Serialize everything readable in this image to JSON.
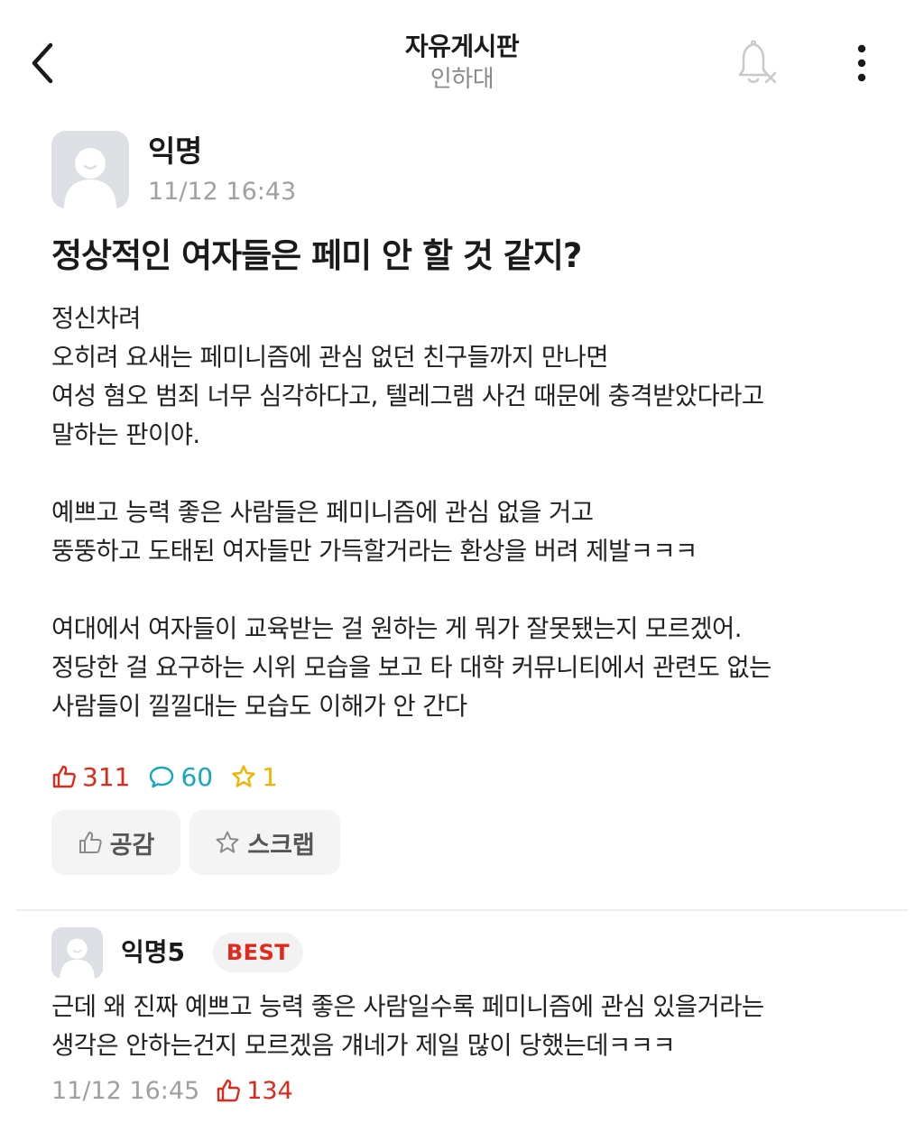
{
  "header": {
    "title": "자유게시판",
    "subtitle": "인하대",
    "back_icon": "chevron-left-icon",
    "bell_icon": "bell-off-icon",
    "more_icon": "more-vertical-icon"
  },
  "post": {
    "author": "익명",
    "time": "11/12 16:43",
    "title": "정상적인 여자들은 페미 안 할 것 같지?",
    "body_paragraphs": [
      [
        "정신차려",
        "오히려 요새는 페미니즘에 관심 없던 친구들까지 만나면",
        "여성 혐오 범죄 너무 심각하다고, 텔레그램 사건 때문에 충격받았다라고",
        "말하는 판이야."
      ],
      [
        "예쁘고 능력 좋은 사람들은 페미니즘에 관심 없을 거고",
        "뚱뚱하고 도태된 여자들만 가득할거라는 환상을 버려 제발ㅋㅋㅋ"
      ],
      [
        "여대에서 여자들이 교육받는 걸 원하는 게 뭐가 잘못됐는지 모르겠어.",
        "정당한 걸 요구하는 시위 모습을 보고 타 대학 커뮤니티에서 관련도 없는",
        "사람들이 낄낄대는 모습도 이해가 안 간다"
      ]
    ],
    "stats": {
      "likes": "311",
      "comments": "60",
      "scraps": "1"
    },
    "actions": {
      "like_label": "공감",
      "scrap_label": "스크랩"
    }
  },
  "comment": {
    "author": "익명5",
    "badge": "BEST",
    "lines": [
      "근데 왜 진짜 예쁘고 능력 좋은 사람일수록 페미니즘에 관심 있을거라는",
      "생각은 안하는건지 모르겠음 걔네가 제일 많이 당했는데ㅋㅋㅋ"
    ],
    "time": "11/12 16:45",
    "likes": "134"
  },
  "colors": {
    "like": "#e0291b",
    "comment": "#12a8c0",
    "scrap": "#f0b400",
    "muted": "#a0a0a0"
  }
}
